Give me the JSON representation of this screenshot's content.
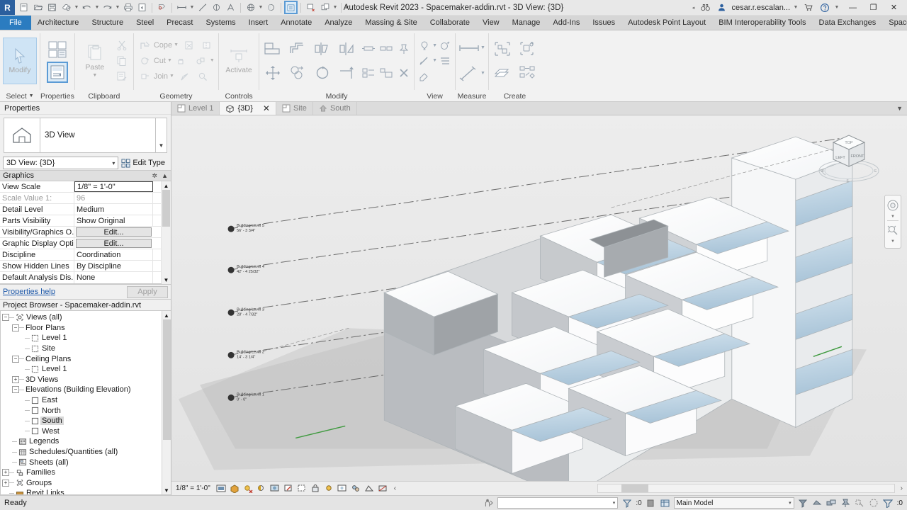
{
  "titlebar": {
    "app_title": "Autodesk Revit 2023 - Spacemaker-addin.rvt - 3D View: {3D}",
    "user": "cesar.r.escalan...",
    "logo": "R",
    "quick_access": [
      {
        "name": "new-icon",
        "label": "New"
      },
      {
        "name": "open-icon",
        "label": "Open"
      },
      {
        "name": "save-icon",
        "label": "Save"
      },
      {
        "name": "save-as-cloud-icon",
        "label": "Save As Cloud Model"
      },
      {
        "name": "undo-icon",
        "label": "Undo"
      },
      {
        "name": "redo-icon",
        "label": "Redo"
      },
      {
        "name": "print-icon",
        "label": "Print"
      },
      {
        "name": "export-icon",
        "label": "Export"
      },
      {
        "name": "measure-icon",
        "label": "Measure"
      },
      {
        "name": "aligned-dimension-icon",
        "label": "Aligned Dimension"
      },
      {
        "name": "tag-icon",
        "label": "Tag by Category"
      },
      {
        "name": "spot-elevation-icon",
        "label": "Spot Elevation"
      },
      {
        "name": "text-icon",
        "label": "Text"
      },
      {
        "name": "default-3d-view-icon",
        "label": "Default 3D View"
      },
      {
        "name": "section-icon",
        "label": "Section"
      },
      {
        "name": "thin-lines-icon",
        "label": "Thin Lines"
      },
      {
        "name": "close-hidden-windows-icon",
        "label": "Close Hidden Windows"
      },
      {
        "name": "switch-windows-icon",
        "label": "Switch Windows"
      }
    ],
    "right_icons": [
      {
        "name": "search-binoculars-icon",
        "label": "Search"
      },
      {
        "name": "autodesk-account-icon",
        "label": "Account"
      },
      {
        "name": "shopping-cart-icon",
        "label": "Autodesk App Store"
      },
      {
        "name": "help-icon",
        "label": "Help"
      }
    ],
    "window_controls": {
      "minimize": "—",
      "maximize": "❐",
      "close": "✕"
    }
  },
  "ribbon": {
    "tabs": [
      {
        "label": "File",
        "kind": "file"
      },
      {
        "label": "Architecture",
        "kind": "normal"
      },
      {
        "label": "Structure",
        "kind": "normal"
      },
      {
        "label": "Steel",
        "kind": "normal"
      },
      {
        "label": "Precast",
        "kind": "normal"
      },
      {
        "label": "Systems",
        "kind": "normal"
      },
      {
        "label": "Insert",
        "kind": "normal"
      },
      {
        "label": "Annotate",
        "kind": "normal"
      },
      {
        "label": "Analyze",
        "kind": "normal"
      },
      {
        "label": "Massing & Site",
        "kind": "normal"
      },
      {
        "label": "Collaborate",
        "kind": "normal"
      },
      {
        "label": "View",
        "kind": "normal"
      },
      {
        "label": "Manage",
        "kind": "normal"
      },
      {
        "label": "Add-Ins",
        "kind": "normal"
      },
      {
        "label": "Issues",
        "kind": "normal"
      },
      {
        "label": "Autodesk Point Layout",
        "kind": "normal"
      },
      {
        "label": "BIM Interoperability Tools",
        "kind": "normal"
      },
      {
        "label": "Data Exchanges",
        "kind": "normal"
      },
      {
        "label": "Spacemaker",
        "kind": "normal"
      }
    ],
    "panels": {
      "select": {
        "label": "Select",
        "modify_label": "Modify",
        "has_dropdown": true
      },
      "properties": {
        "label": "Properties",
        "button_label": "Properties"
      },
      "clipboard": {
        "label": "Clipboard",
        "paste_label": "Paste",
        "items": [
          "cut-icon",
          "copy-icon",
          "match-type-icon"
        ]
      },
      "geometry": {
        "label": "Geometry",
        "items": [
          {
            "label": "Cope",
            "icon": "cope-icon",
            "dropdown": true
          },
          {
            "label": "Cut",
            "icon": "cut-geometry-icon",
            "dropdown": true
          },
          {
            "label": "Join",
            "icon": "join-geometry-icon",
            "dropdown": true
          },
          {
            "label": "",
            "icon": "demolish-icon",
            "dropdown": false
          },
          {
            "label": "",
            "icon": "split-face-icon",
            "dropdown": false
          },
          {
            "label": "",
            "icon": "paint-icon",
            "dropdown": true
          }
        ]
      },
      "controls": {
        "label": "Controls",
        "activate_label": "Activate"
      },
      "modify": {
        "label": "Modify",
        "items": [
          "align-icon",
          "offset-icon",
          "mirror-pick-icon",
          "mirror-draw-icon",
          "move-icon",
          "copy-move-icon",
          "rotate-icon",
          "trim-extend-icon",
          "split-icon",
          "array-icon",
          "scale-icon",
          "pin-icon",
          "unpin-icon",
          "delete-icon"
        ]
      },
      "view": {
        "label": "View",
        "items": [
          "visibility-icon",
          "render-icon",
          "linework-icon",
          "hide-icon",
          "gradient-icon"
        ]
      },
      "measure": {
        "label": "Measure",
        "items": [
          "measure-between-icon",
          "measure-along-icon"
        ]
      },
      "create": {
        "label": "Create",
        "items": [
          "create-similar-icon",
          "create-group-icon",
          "create-part-icon",
          "create-assembly-icon"
        ]
      }
    }
  },
  "properties": {
    "palette_title": "Properties",
    "category": "3D View",
    "type": "3D View: {3D}",
    "edit_type_label": "Edit Type",
    "group_label": "Graphics",
    "rows": [
      {
        "name": "View Scale",
        "value": "1/8\" = 1'-0\"",
        "style": "boxed"
      },
      {
        "name": "Scale Value     1:",
        "value": "96",
        "style": "dim"
      },
      {
        "name": "Detail Level",
        "value": "Medium",
        "style": "text"
      },
      {
        "name": "Parts Visibility",
        "value": "Show Original",
        "style": "text"
      },
      {
        "name": "Visibility/Graphics O...",
        "value": "Edit...",
        "style": "button"
      },
      {
        "name": "Graphic Display Opti...",
        "value": "Edit...",
        "style": "button"
      },
      {
        "name": "Discipline",
        "value": "Coordination",
        "style": "text"
      },
      {
        "name": "Show Hidden Lines",
        "value": "By Discipline",
        "style": "text"
      },
      {
        "name": "Default Analysis Dis...",
        "value": "None",
        "style": "text"
      }
    ],
    "help_link": "Properties help",
    "apply_label": "Apply"
  },
  "project_browser": {
    "title": "Project Browser - Spacemaker-addin.rvt",
    "nodes": [
      {
        "label": "Views (all)",
        "depth": 0,
        "expander": "−",
        "icon": "views-icon",
        "selected": false
      },
      {
        "label": "Floor Plans",
        "depth": 1,
        "expander": "−",
        "icon": "none",
        "selected": false
      },
      {
        "label": "Level 1",
        "depth": 2,
        "expander": "none",
        "icon": "view-icon",
        "selected": false
      },
      {
        "label": "Site",
        "depth": 2,
        "expander": "none",
        "icon": "view-icon",
        "selected": false
      },
      {
        "label": "Ceiling Plans",
        "depth": 1,
        "expander": "−",
        "icon": "none",
        "selected": false
      },
      {
        "label": "Level 1",
        "depth": 2,
        "expander": "none",
        "icon": "view-icon",
        "selected": false
      },
      {
        "label": "3D Views",
        "depth": 1,
        "expander": "+",
        "icon": "none",
        "selected": false
      },
      {
        "label": "Elevations (Building Elevation)",
        "depth": 1,
        "expander": "−",
        "icon": "none",
        "selected": false
      },
      {
        "label": "East",
        "depth": 2,
        "expander": "none",
        "icon": "view-icon",
        "selected": false
      },
      {
        "label": "North",
        "depth": 2,
        "expander": "none",
        "icon": "view-icon",
        "selected": false
      },
      {
        "label": "South",
        "depth": 2,
        "expander": "none",
        "icon": "view-icon",
        "selected": true
      },
      {
        "label": "West",
        "depth": 2,
        "expander": "none",
        "icon": "view-icon",
        "selected": false
      },
      {
        "label": "Legends",
        "depth": 1,
        "expander": "none",
        "icon": "legend-icon",
        "selected": false
      },
      {
        "label": "Schedules/Quantities (all)",
        "depth": 1,
        "expander": "none",
        "icon": "schedule-icon",
        "selected": false
      },
      {
        "label": "Sheets (all)",
        "depth": 1,
        "expander": "none",
        "icon": "sheet-icon",
        "selected": false
      },
      {
        "label": "Families",
        "depth": 0,
        "expander": "+",
        "icon": "families-icon",
        "selected": false
      },
      {
        "label": "Groups",
        "depth": 0,
        "expander": "+",
        "icon": "groups-icon",
        "selected": false
      },
      {
        "label": "Revit Links",
        "depth": 0,
        "expander": "none",
        "icon": "links-icon",
        "selected": false
      }
    ]
  },
  "view_tabs": [
    {
      "label": "Level 1",
      "icon": "floorplan-icon",
      "active": false,
      "closable": false
    },
    {
      "label": "{3D}",
      "icon": "view3d-icon",
      "active": true,
      "closable": true
    },
    {
      "label": "Site",
      "icon": "floorplan-icon",
      "active": false,
      "closable": false
    },
    {
      "label": "South",
      "icon": "elevation-icon",
      "active": false,
      "closable": false
    }
  ],
  "viewport": {
    "view_cube": {
      "top": "TOP",
      "left": "LEFT",
      "front": "FRONT",
      "north": "N",
      "south": "S",
      "east": "E",
      "west": "W"
    },
    "nav_bar": [
      {
        "name": "steering-wheel-icon",
        "label": "Full Navigation Wheel"
      },
      {
        "name": "zoom-region-icon",
        "label": "Zoom"
      }
    ],
    "level_markers": [
      {
        "label": "Building Level 5",
        "elevation": "56' - 3 3/4\""
      },
      {
        "label": "Building Level 4",
        "elevation": "42' - 4 25/32\""
      },
      {
        "label": "Building Level 3",
        "elevation": "28' - 4 7/32\""
      },
      {
        "label": "Building Level 2",
        "elevation": "14' - 3 1/4\""
      },
      {
        "label": "Building Level 1",
        "elevation": "0' - 0\""
      }
    ],
    "colors": {
      "background": "#e9e9e9",
      "mass_white": "#fdfdfd",
      "mass_shadow": "#9b9b9b",
      "glass_blue": "#c2d7e6",
      "ground": "#bdbdbd",
      "green_line": "#3f9a3f"
    }
  },
  "view_control_bar": {
    "scale": "1/8\" = 1'-0\"",
    "icons": [
      {
        "name": "detail-level-icon",
        "label": "Detail Level"
      },
      {
        "name": "visual-style-icon",
        "label": "Visual Style"
      },
      {
        "name": "sun-path-icon",
        "label": "Sun Path Off"
      },
      {
        "name": "shadows-icon",
        "label": "Shadows Off"
      },
      {
        "name": "render-dialog-icon",
        "label": "Show Rendering Dialog"
      },
      {
        "name": "crop-view-icon",
        "label": "Crop View"
      },
      {
        "name": "crop-region-icon",
        "label": "Show Crop Region"
      },
      {
        "name": "lock-3d-view-icon",
        "label": "Lock 3D View"
      },
      {
        "name": "temp-hide-isolate-icon",
        "label": "Temporary Hide/Isolate"
      },
      {
        "name": "reveal-hidden-icon",
        "label": "Reveal Hidden Elements"
      },
      {
        "name": "worksharing-display-icon",
        "label": "Worksharing Display"
      },
      {
        "name": "analytical-model-icon",
        "label": "Show Analytical Model"
      },
      {
        "name": "constraints-icon",
        "label": "Reveal Constraints"
      },
      {
        "name": "more-icon",
        "label": "More"
      }
    ],
    "expand_arrow": "‹",
    "end_arrow": "›"
  },
  "statusbar": {
    "ready": "Ready",
    "filter_dropdown_value": "",
    "selection_count": ":0",
    "workset": "Main Model",
    "filter_count": ":0",
    "left_icon": "model-select-icon",
    "icons": [
      {
        "name": "design-options-icon",
        "label": "Design Options"
      },
      {
        "name": "worksets-icon",
        "label": "Worksets"
      },
      {
        "name": "editable-only-icon",
        "label": "Editable Only"
      },
      {
        "name": "exclude-options-icon",
        "label": "Exclude Options"
      },
      {
        "name": "select-links-icon",
        "label": "Select Links"
      },
      {
        "name": "select-pinned-icon",
        "label": "Select Pinned Elements"
      },
      {
        "name": "select-underlay-icon",
        "label": "Select Elements by Face"
      },
      {
        "name": "drag-elements-icon",
        "label": "Drag Elements on Selection"
      },
      {
        "name": "filter-icon",
        "label": "Filter"
      }
    ]
  }
}
